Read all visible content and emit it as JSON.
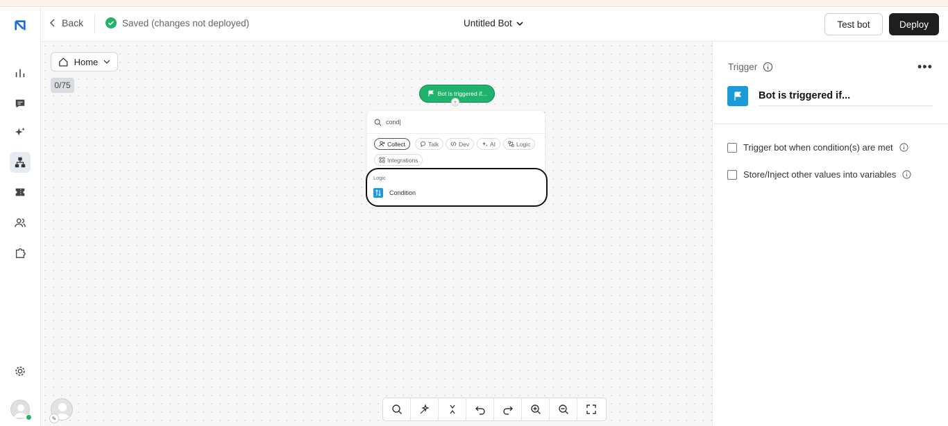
{
  "header": {
    "back_label": "Back",
    "saved_status": "Saved (changes not deployed)",
    "bot_name": "Untitled Bot",
    "test_button": "Test bot",
    "deploy_button": "Deploy"
  },
  "sidebar": {
    "items": [
      {
        "name": "analytics",
        "icon": "bar-chart-icon"
      },
      {
        "name": "inbox",
        "icon": "chat-icon"
      },
      {
        "name": "ai",
        "icon": "sparkles-icon"
      },
      {
        "name": "flows",
        "icon": "sitemap-icon",
        "active": true
      },
      {
        "name": "tickets",
        "icon": "ticket-icon"
      },
      {
        "name": "contacts",
        "icon": "users-icon"
      },
      {
        "name": "integrations",
        "icon": "puzzle-icon"
      },
      {
        "name": "settings",
        "icon": "gear-icon"
      }
    ]
  },
  "canvas": {
    "home_label": "Home",
    "counter": "0/75",
    "trigger_node_label": "Bot is triggered if...",
    "search_value": "cond|",
    "chips": [
      {
        "label": "Collect",
        "icon": "collect-icon",
        "selected": true
      },
      {
        "label": "Talk",
        "icon": "speech-bubble-icon"
      },
      {
        "label": "Dev",
        "icon": "code-icon"
      },
      {
        "label": "AI",
        "icon": "sparkles-icon"
      },
      {
        "label": "Logic",
        "icon": "logic-icon"
      },
      {
        "label": "Integrations",
        "icon": "integrations-icon"
      }
    ],
    "results_group": "Logic",
    "result_item": "Condition",
    "toolbar": [
      "search-icon",
      "magic-icon",
      "collapse-icon",
      "undo-icon",
      "redo-icon",
      "zoom-in-icon",
      "zoom-out-icon",
      "fullscreen-icon"
    ]
  },
  "right_panel": {
    "section_label": "Trigger",
    "block_name": "Bot is triggered if...",
    "options": [
      "Trigger bot when condition(s) are met",
      "Store/Inject other values into variables"
    ]
  },
  "colors": {
    "trigger_green": "#1fb46e",
    "accent_blue": "#1c9bd8",
    "deploy_dark": "#1e1e1e",
    "saved_green": "#22b26b"
  }
}
